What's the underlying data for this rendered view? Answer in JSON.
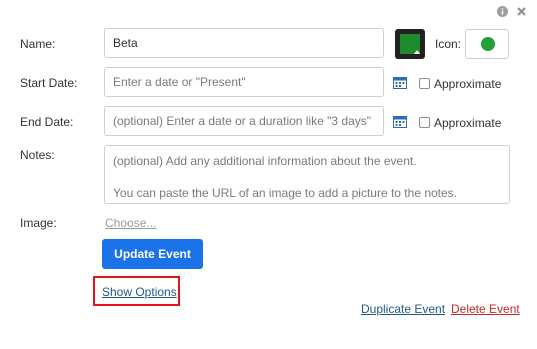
{
  "form": {
    "name_label": "Name:",
    "name_value": "Beta",
    "icon_label": "Icon:",
    "start_label": "Start Date:",
    "start_placeholder": "Enter a date or \"Present\"",
    "end_label": "End Date:",
    "end_placeholder": "(optional) Enter a date or a duration like \"3 days\"",
    "approximate_label": "Approximate",
    "notes_label": "Notes:",
    "notes_placeholder": "(optional) Add any additional information about the event.\n\nYou can paste the URL of an image to add a picture to the notes.",
    "image_label": "Image:",
    "choose_link": "Choose...",
    "update_button": "Update Event",
    "show_options_link": "Show Options",
    "duplicate_link": "Duplicate Event",
    "delete_link": "Delete Event"
  },
  "colors": {
    "event_color": "#1f8a2e",
    "icon_dot": "#22a03a",
    "primary": "#1a73e8",
    "link": "#1f5a8a",
    "delete": "#c62828",
    "highlight": "#e0141b"
  },
  "icons": [
    "info-icon",
    "close-icon",
    "calendar-icon",
    "color-swatch-icon",
    "icon-dot"
  ]
}
